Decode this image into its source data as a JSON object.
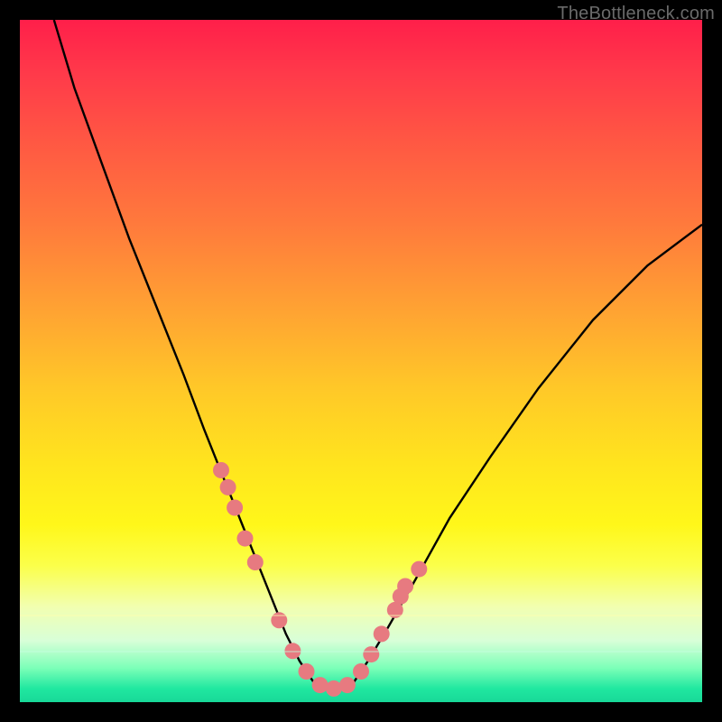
{
  "watermark": "TheBottleneck.com",
  "chart_data": {
    "type": "line",
    "title": "",
    "xlabel": "",
    "ylabel": "",
    "xlim": [
      0,
      100
    ],
    "ylim": [
      0,
      100
    ],
    "series": [
      {
        "name": "bottleneck-curve",
        "x": [
          5,
          8,
          12,
          16,
          20,
          24,
          27,
          29,
          31,
          33,
          35,
          37,
          39,
          41,
          43,
          45,
          47,
          49,
          51,
          54,
          58,
          63,
          69,
          76,
          84,
          92,
          100
        ],
        "y": [
          100,
          90,
          79,
          68,
          58,
          48,
          40,
          35,
          30,
          25,
          20,
          15,
          10,
          6,
          3,
          2,
          2,
          3,
          6,
          11,
          18,
          27,
          36,
          46,
          56,
          64,
          70
        ]
      }
    ],
    "markers": {
      "name": "highlight-dots",
      "x": [
        29.5,
        30.5,
        31.5,
        33.0,
        34.5,
        38.0,
        40.0,
        42.0,
        44.0,
        46.0,
        48.0,
        50.0,
        51.5,
        53.0,
        55.0,
        55.8,
        56.5,
        58.5
      ],
      "y": [
        34.0,
        31.5,
        28.5,
        24.0,
        20.5,
        12.0,
        7.5,
        4.5,
        2.5,
        2.0,
        2.5,
        4.5,
        7.0,
        10.0,
        13.5,
        15.5,
        17.0,
        19.5
      ]
    }
  }
}
